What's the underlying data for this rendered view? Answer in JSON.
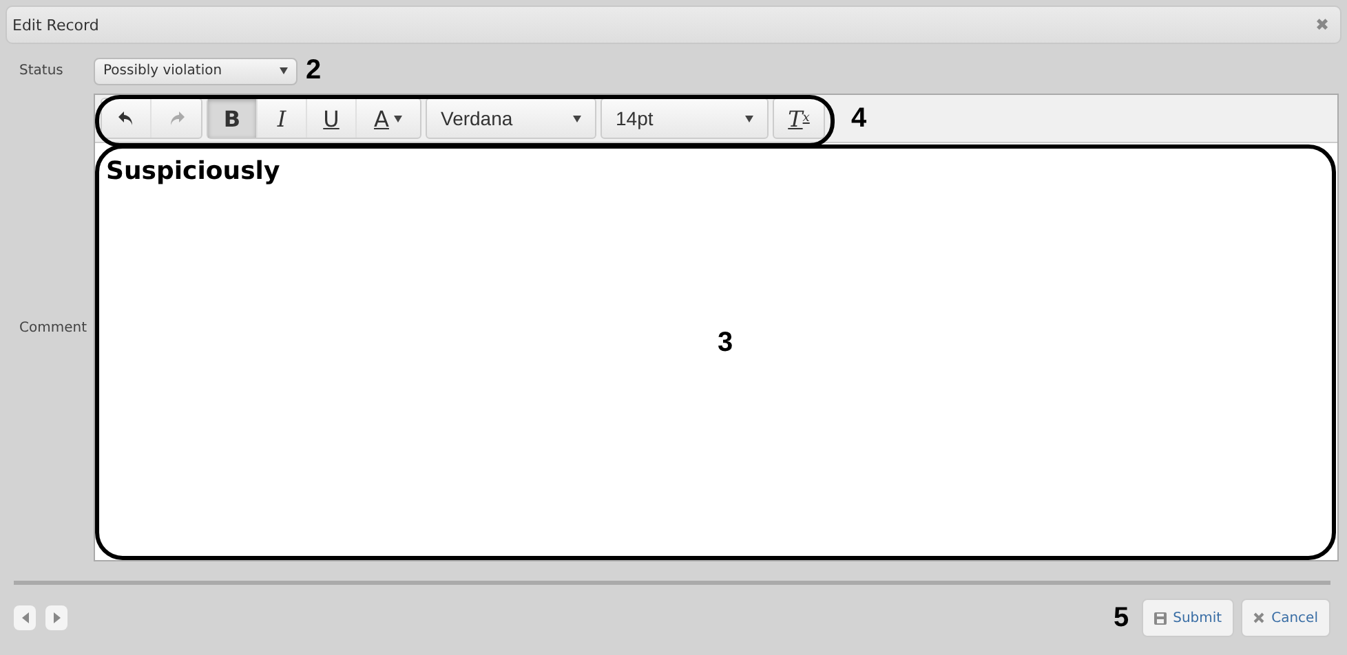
{
  "window": {
    "title": "Edit Record",
    "close": "✖"
  },
  "status": {
    "label": "Status",
    "value": "Possibly violation",
    "callout": "2"
  },
  "comment": {
    "label": "Comment",
    "toolbar": {
      "callout": "4",
      "items": [
        {
          "kind": "undo",
          "disabled": false,
          "selected": false
        },
        {
          "kind": "redo",
          "disabled": true,
          "selected": false
        },
        {
          "kind": "bold",
          "label": "B",
          "disabled": false,
          "selected": true
        },
        {
          "kind": "italic",
          "label": "I",
          "disabled": false,
          "selected": false
        },
        {
          "kind": "underline",
          "label": "U",
          "disabled": false,
          "selected": false
        },
        {
          "kind": "color",
          "label": "A",
          "disabled": false,
          "selected": false
        },
        {
          "kind": "font",
          "label": "Verdana",
          "disabled": false,
          "selected": false
        },
        {
          "kind": "size",
          "label": "14pt",
          "disabled": false,
          "selected": false
        },
        {
          "kind": "clear",
          "label": "T",
          "sub": "x",
          "disabled": false,
          "selected": false
        }
      ]
    },
    "text": "Suspiciously",
    "callout": "3"
  },
  "footer": {
    "callout": "5",
    "buttons": [
      {
        "kind": "submit",
        "label": "Submit"
      },
      {
        "kind": "cancel",
        "label": "Cancel"
      }
    ]
  }
}
